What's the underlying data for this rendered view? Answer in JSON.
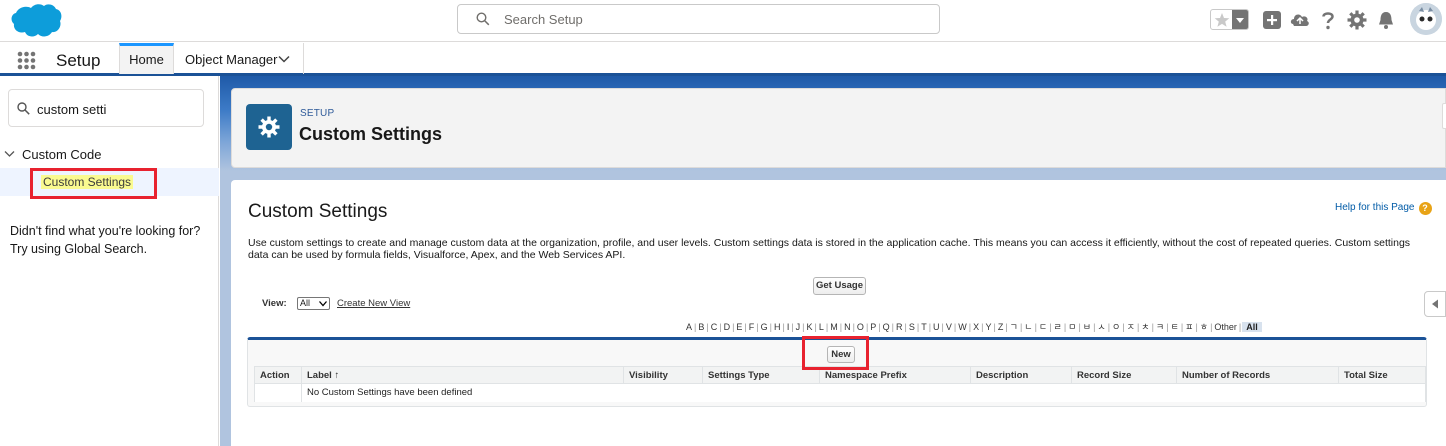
{
  "header": {
    "search_placeholder": "Search Setup",
    "icons": [
      "favorites-star-icon",
      "favorites-dropdown-icon",
      "global-actions-add-icon",
      "trailhead-icon",
      "help-icon",
      "setup-gear-icon",
      "notifications-bell-icon",
      "user-avatar-icon"
    ],
    "accent_color": "#1b96ff"
  },
  "context_bar": {
    "app_name": "Setup",
    "tabs": [
      {
        "label": "Home",
        "active": true
      },
      {
        "label": "Object Manager",
        "active": false
      }
    ]
  },
  "sidebar": {
    "quick_find_value": "custom setti",
    "tree": {
      "group_label": "Custom Code",
      "expanded": true,
      "items": [
        {
          "label": "Custom Settings",
          "selected": true
        }
      ]
    },
    "not_found_line1": "Didn't find what you're looking for?",
    "not_found_line2": "Try using Global Search."
  },
  "page_header": {
    "breadcrumb": "SETUP",
    "title": "Custom Settings"
  },
  "content": {
    "title": "Custom Settings",
    "help_link": "Help for this Page",
    "description": "Use custom settings to create and manage custom data at the organization, profile, and user levels. Custom settings data is stored in the application cache. This means you can access it efficiently, without the cost of repeated queries. Custom settings data can be used by formula fields, Visualforce, Apex, and the Web Services API.",
    "get_usage_label": "Get Usage",
    "view_label": "View:",
    "view_selected": "All",
    "create_view_link": "Create New View",
    "alpha_filter": [
      "A",
      "B",
      "C",
      "D",
      "E",
      "F",
      "G",
      "H",
      "I",
      "J",
      "K",
      "L",
      "M",
      "N",
      "O",
      "P",
      "Q",
      "R",
      "S",
      "T",
      "U",
      "V",
      "W",
      "X",
      "Y",
      "Z",
      "ㄱ",
      "ㄴ",
      "ㄷ",
      "ㄹ",
      "ㅁ",
      "ㅂ",
      "ㅅ",
      "ㅇ",
      "ㅈ",
      "ㅊ",
      "ㅋ",
      "ㅌ",
      "ㅍ",
      "ㅎ",
      "Other"
    ],
    "alpha_all": "All",
    "new_button_label": "New",
    "table": {
      "columns": [
        "Action",
        "Label ↑",
        "Visibility",
        "Settings Type",
        "Namespace Prefix",
        "Description",
        "Record Size",
        "Number of Records",
        "Total Size"
      ],
      "empty_message": "No Custom Settings have been defined"
    }
  },
  "highlight_color": "#e8222f"
}
